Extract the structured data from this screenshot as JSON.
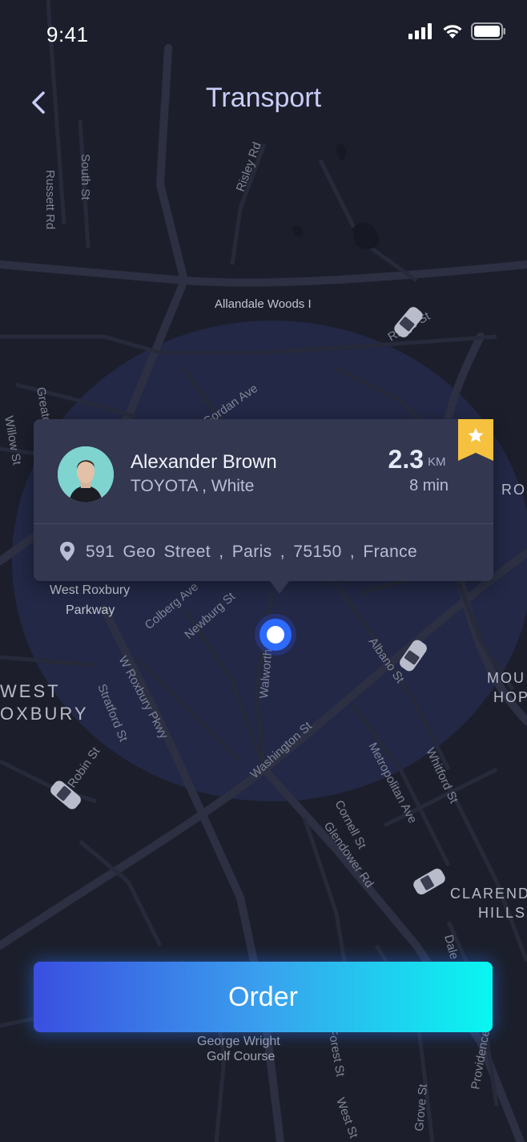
{
  "status": {
    "time": "9:41"
  },
  "header": {
    "title": "Transport"
  },
  "map_labels": {
    "allandale": "Allandale Woods I",
    "ridge": "Ridge St",
    "west_roxbury_parkway_1": "West Roxbury",
    "west_roxbury_parkway_2": "Parkway",
    "west": "WEST",
    "roxbury": "OXBURY",
    "mount_1": "MOU",
    "mount_2": "HOP",
    "claren_1": "CLAREND",
    "claren_2": "HILLS",
    "golf_1": "George Wright",
    "golf_2": "Golf Course",
    "ros": "ROS",
    "russett": "Russett Rd",
    "south": "South St",
    "risley": "Risley Rd",
    "greaton": "Greaton",
    "willow": "Willow St",
    "gordan": "Gordan Ave",
    "colberg": "Colberg Ave",
    "newburg": "Newburg St",
    "walworth": "Walworth",
    "washington": "Washington St",
    "w_roxbury_pkwy": "W Roxbury Pkwy",
    "stratford": "Stratford St",
    "robin": "Robin St",
    "albano": "Albano St",
    "metropolitan": "Metropolitan Ave",
    "whitford": "Whitford St",
    "cornell": "Cornell St",
    "glendower": "Glendower Rd",
    "dale": "Dale",
    "forest": "Forest St",
    "west_st": "West St",
    "providence": "Providence St",
    "grove": "Grove St"
  },
  "driver": {
    "name": "Alexander Brown",
    "car": "TOYOTA , White",
    "distance": "2.3",
    "distance_unit": "KM",
    "eta": "8 min",
    "address": "591  Geo Street , Paris , 75150 , France"
  },
  "order_button": "Order",
  "colors": {
    "background": "#1c1f2b",
    "road": "#2b2f3f",
    "radius": "#232a4a",
    "card": "#333750",
    "title": "#c9cdf7",
    "star": "#f5c13e",
    "pin": "#2d6bff"
  },
  "icons": [
    "back-icon",
    "signal-icon",
    "wifi-icon",
    "battery-icon",
    "location-pin-icon",
    "star-bookmark-icon",
    "car-icon"
  ]
}
